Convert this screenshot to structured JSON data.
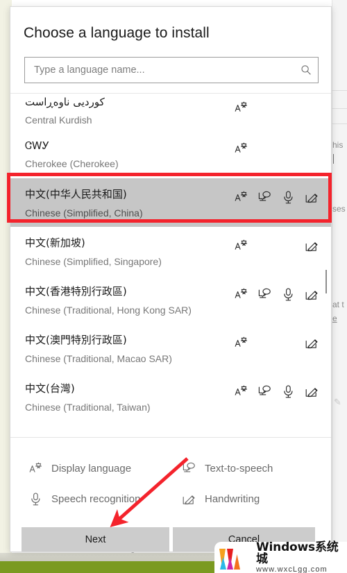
{
  "dialog": {
    "title": "Choose a language to install",
    "search": {
      "placeholder": "Type a language name...",
      "value": "",
      "icon": "search-icon"
    },
    "languages": [
      {
        "native": "کوردیی ناوەڕاست",
        "english": "Central Kurdish",
        "features": [
          "display-language"
        ],
        "selected": false,
        "clipped_top": true
      },
      {
        "native": "ᏣᎳᎩ",
        "english": "Cherokee (Cherokee)",
        "features": [
          "display-language"
        ],
        "selected": false,
        "clipped_top": false
      },
      {
        "native": "中文(中华人民共和国)",
        "english": "Chinese (Simplified, China)",
        "features": [
          "display-language",
          "text-to-speech",
          "speech-recognition",
          "handwriting"
        ],
        "selected": true,
        "clipped_top": false
      },
      {
        "native": "中文(新加坡)",
        "english": "Chinese (Simplified, Singapore)",
        "features": [
          "display-language",
          "handwriting"
        ],
        "selected": false,
        "clipped_top": false
      },
      {
        "native": "中文(香港特別行政區)",
        "english": "Chinese (Traditional, Hong Kong SAR)",
        "features": [
          "display-language",
          "text-to-speech",
          "speech-recognition",
          "handwriting"
        ],
        "selected": false,
        "clipped_top": false
      },
      {
        "native": "中文(澳門特別行政區)",
        "english": "Chinese (Traditional, Macao SAR)",
        "features": [
          "display-language",
          "handwriting"
        ],
        "selected": false,
        "clipped_top": false
      },
      {
        "native": "中文(台灣)",
        "english": "Chinese (Traditional, Taiwan)",
        "features": [
          "display-language",
          "text-to-speech",
          "speech-recognition",
          "handwriting"
        ],
        "selected": false,
        "clipped_top": false
      }
    ],
    "legend": [
      {
        "icon": "display-language-icon",
        "label": "Display language"
      },
      {
        "icon": "text-to-speech-icon",
        "label": "Text-to-speech"
      },
      {
        "icon": "speech-recognition-icon",
        "label": "Speech recognition"
      },
      {
        "icon": "handwriting-icon",
        "label": "Handwriting"
      }
    ],
    "buttons": {
      "next": "Next",
      "cancel": "Cancel"
    }
  },
  "background": {
    "fragments": [
      "his",
      "ses",
      "at t",
      "e"
    ]
  },
  "annotations": {
    "highlight_color": "#f4232c",
    "arrow_color": "#f4232c"
  },
  "watermark": {
    "title": "Windows系统城",
    "url": "www.wxcLgg.com",
    "colors": [
      "#f5a01e",
      "#e61e1e",
      "#2bb8e8",
      "#cf23a6",
      "#f4721e"
    ]
  }
}
